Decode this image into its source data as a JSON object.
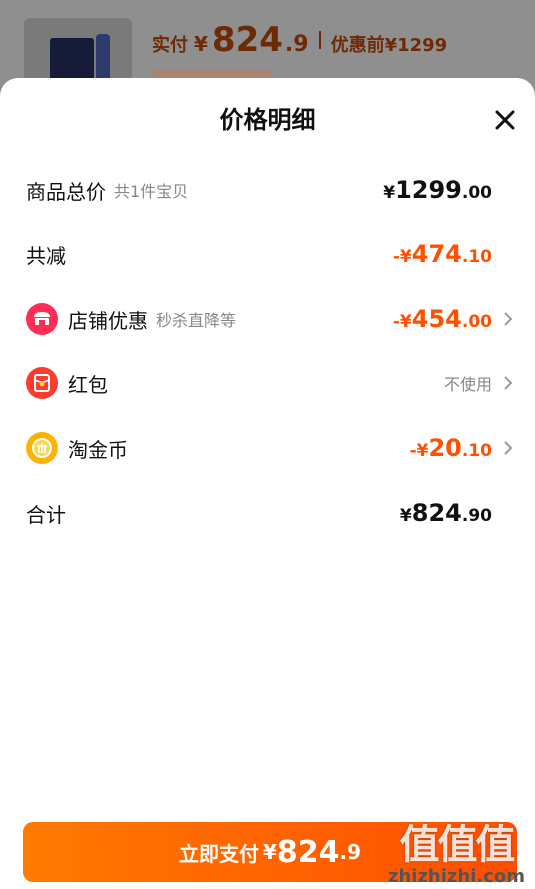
{
  "background": {
    "pay_label": "实付",
    "yen": "¥",
    "price_int": "824",
    "price_dec": ".9",
    "original_label": "优惠前",
    "original_price": "¥1299"
  },
  "sheet": {
    "title": "价格明细",
    "rows": {
      "total": {
        "label": "商品总价",
        "sub": "共1件宝贝",
        "yen": "¥",
        "int": "1299",
        "dec": ".00"
      },
      "reduce": {
        "label": "共减",
        "yen": "-¥",
        "int": "474",
        "dec": ".10"
      },
      "shop": {
        "label": "店铺优惠",
        "sub": "秒杀直降等",
        "yen": "-¥",
        "int": "454",
        "dec": ".00",
        "icon": "shop-icon"
      },
      "redpacket": {
        "label": "红包",
        "value": "不使用",
        "icon": "red-packet-icon"
      },
      "coin": {
        "label": "淘金币",
        "yen": "-¥",
        "int": "20",
        "dec": ".10",
        "icon": "gold-coin-icon"
      },
      "sum": {
        "label": "合计",
        "yen": "¥",
        "int": "824",
        "dec": ".90"
      }
    }
  },
  "pay_button": {
    "label": "立即支付",
    "yen": "¥",
    "int": "824",
    "dec": ".9"
  },
  "watermark": {
    "text": "值值值",
    "domain": "zhizhizhi.com"
  },
  "colors": {
    "accent": "#ff5000",
    "shop_icon": "#ff2d55",
    "red_packet_icon": "#ff3b30",
    "coin_icon": "#ffb300"
  }
}
